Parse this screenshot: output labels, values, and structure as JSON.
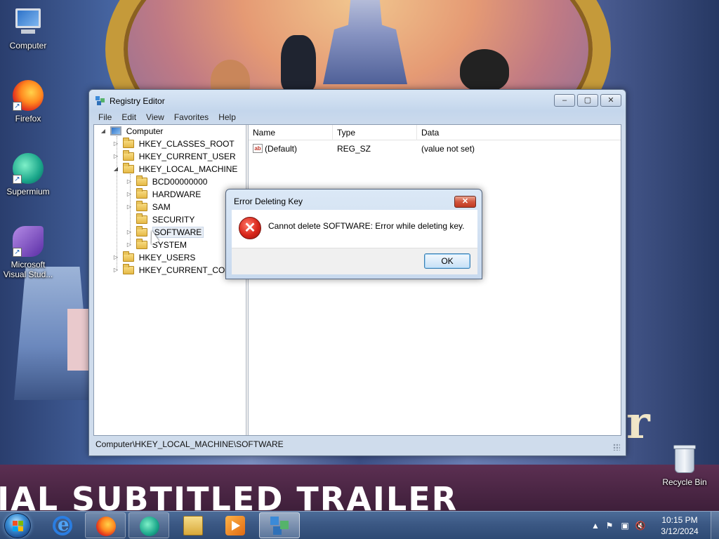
{
  "desktop": {
    "icons": [
      {
        "label": "Computer",
        "icon": "computer-icon"
      },
      {
        "label": "Firefox",
        "icon": "firefox-icon"
      },
      {
        "label": "Supermium",
        "icon": "supermium-icon"
      },
      {
        "label": "Microsoft Visual Stud...",
        "icon": "visual-studio-icon"
      },
      {
        "label": "Recycle Bin",
        "icon": "recycle-bin-icon"
      }
    ],
    "wallpaper_banner": "IAL SUBTITLED TRAILER",
    "wallpaper_letter": "r"
  },
  "regedit": {
    "title": "Registry Editor",
    "caption_buttons": {
      "minimize": "–",
      "maximize": "▢",
      "close": "✕"
    },
    "menu": [
      "File",
      "Edit",
      "View",
      "Favorites",
      "Help"
    ],
    "tree": {
      "root": "Computer",
      "hives": [
        "HKEY_CLASSES_ROOT",
        "HKEY_CURRENT_USER",
        "HKEY_LOCAL_MACHINE",
        "HKEY_USERS",
        "HKEY_CURRENT_CONFIG"
      ],
      "hklm_children": [
        "BCD00000000",
        "HARDWARE",
        "SAM",
        "SECURITY",
        "SOFTWARE",
        "SYSTEM"
      ],
      "selected": "SOFTWARE"
    },
    "list": {
      "columns": [
        "Name",
        "Type",
        "Data"
      ],
      "rows": [
        {
          "name": "(Default)",
          "type": "REG_SZ",
          "data": "(value not set)",
          "icon": "string-value-icon"
        }
      ]
    },
    "status": "Computer\\HKEY_LOCAL_MACHINE\\SOFTWARE"
  },
  "dialog": {
    "title": "Error Deleting Key",
    "close_glyph": "✕",
    "icon": "error-icon",
    "icon_glyph": "✕",
    "message": "Cannot delete SOFTWARE:  Error while deleting key.",
    "ok_label": "OK"
  },
  "taskbar": {
    "items": [
      {
        "name": "internet-explorer",
        "state": "pinned"
      },
      {
        "name": "firefox",
        "state": "running"
      },
      {
        "name": "supermium",
        "state": "running"
      },
      {
        "name": "file-explorer",
        "state": "pinned"
      },
      {
        "name": "media-player",
        "state": "pinned"
      },
      {
        "name": "registry-editor",
        "state": "active"
      }
    ],
    "clock": {
      "time": "10:15 PM",
      "date": "3/12/2024"
    }
  }
}
